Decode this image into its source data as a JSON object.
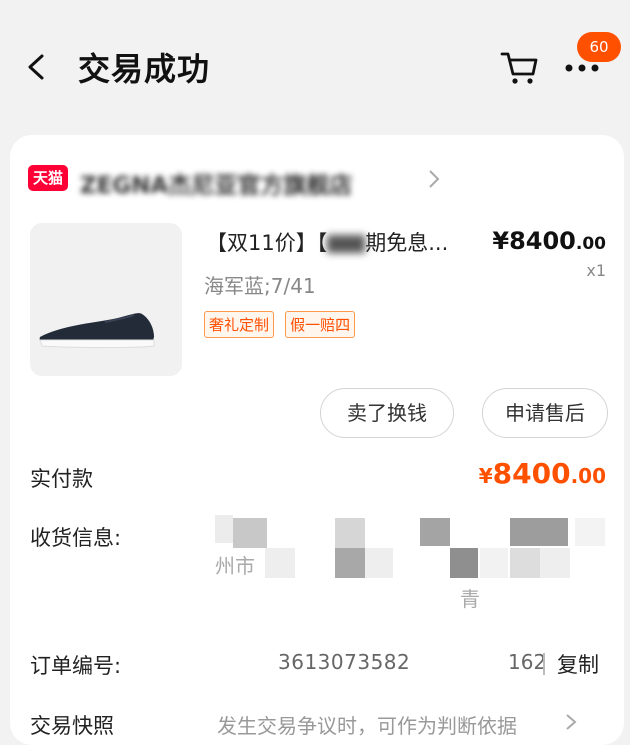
{
  "header": {
    "title": "交易成功",
    "message_badge": "60"
  },
  "order": {
    "shop_badge": "天猫",
    "shop_name": "ZEGNA杰尼亚官方旗舰店",
    "product": {
      "title_prefix": "【双11价】【",
      "title_suffix": "期免息...",
      "price_int": "¥8400",
      "price_dec": ".00",
      "quantity": "x1",
      "sku": "海军蓝;7/41",
      "tags": [
        "奢礼定制",
        "假一赔四"
      ]
    },
    "buttons": {
      "sell": "卖了换钱",
      "after_sale": "申请售后"
    },
    "paid": {
      "label": "实付款",
      "currency": "¥",
      "amount_int": "8400",
      "amount_dec": ".00"
    },
    "address": {
      "label": "收货信息:",
      "line_fragment_1": "州市",
      "line_fragment_2": "青"
    },
    "order_number": {
      "label": "订单编号:",
      "prefix": "3613073582",
      "suffix": "162",
      "copy_label": "复制"
    },
    "snapshot": {
      "label": "交易快照",
      "text": "发生交易争议时，可作为判断依据"
    }
  }
}
